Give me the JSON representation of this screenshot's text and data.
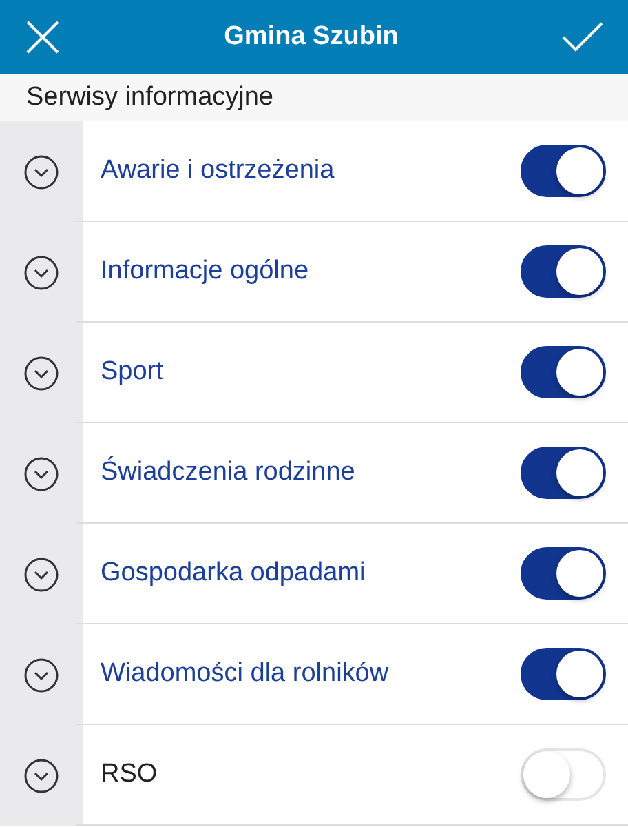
{
  "header": {
    "title": "Gmina Szubin"
  },
  "section": {
    "title": "Serwisy informacyjne"
  },
  "services": [
    {
      "label": "Awarie i ostrzeżenia",
      "on": true
    },
    {
      "label": "Informacje ogólne",
      "on": true
    },
    {
      "label": "Sport",
      "on": true
    },
    {
      "label": "Świadczenia rodzinne",
      "on": true
    },
    {
      "label": "Gospodarka odpadami",
      "on": true
    },
    {
      "label": "Wiadomości dla rolników",
      "on": true
    },
    {
      "label": "RSO",
      "on": false
    }
  ]
}
